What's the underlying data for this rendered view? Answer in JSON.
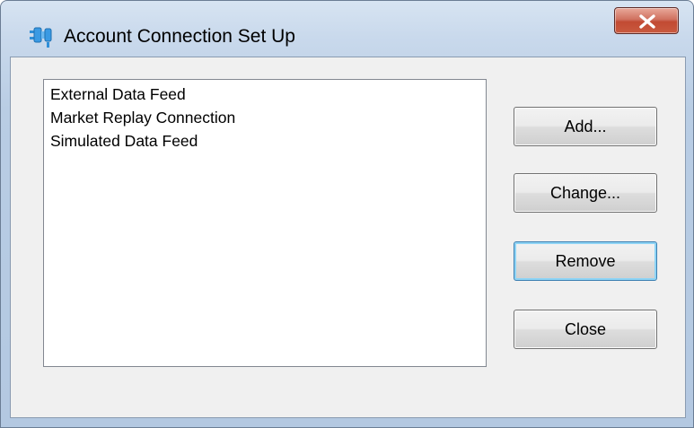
{
  "window": {
    "title": "Account Connection Set Up",
    "close_symbol": "x"
  },
  "list": {
    "items": [
      "External Data Feed",
      "Market Replay Connection",
      "Simulated Data Feed"
    ]
  },
  "buttons": {
    "add": "Add...",
    "change": "Change...",
    "remove": "Remove",
    "close": "Close"
  },
  "icons": {
    "title_icon": "plug-connection-icon",
    "close_icon": "close-icon"
  },
  "colors": {
    "close_button": "#c95a3f",
    "default_button_border": "#3c7fb1",
    "title_icon": "#2f8fd8"
  }
}
